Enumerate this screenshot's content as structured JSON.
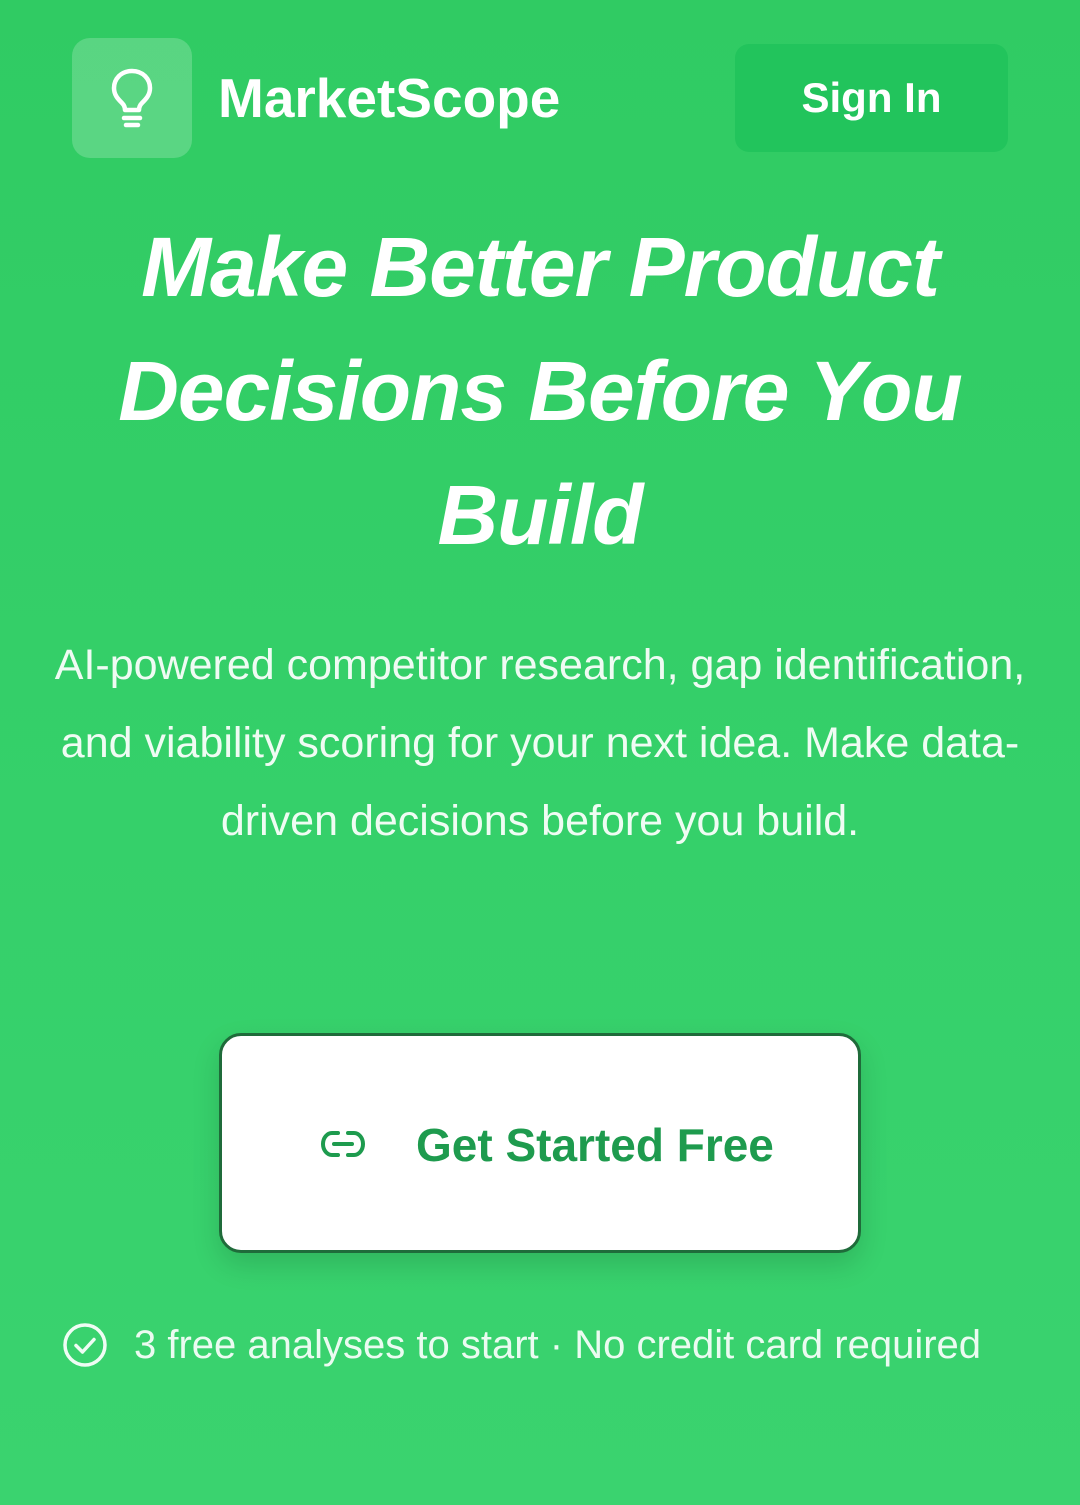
{
  "header": {
    "logo_icon": "lightbulb-icon",
    "brand_name": "MarketScope",
    "sign_in_label": "Sign In"
  },
  "hero": {
    "title": "Make Better Product Decisions Before You Build",
    "subtitle": "AI-powered competitor research, gap identification, and viability scoring for your next idea. Make data-driven decisions before you build."
  },
  "cta": {
    "icon": "link-icon",
    "label": "Get Started Free"
  },
  "footnote": {
    "icon": "check-circle-icon",
    "text": "3 free analyses to start · No credit card required"
  },
  "colors": {
    "background": "#35d06a",
    "sign_in_background": "#22c45c",
    "cta_text": "#1e9b4e",
    "cta_border": "#1f6b3a"
  }
}
